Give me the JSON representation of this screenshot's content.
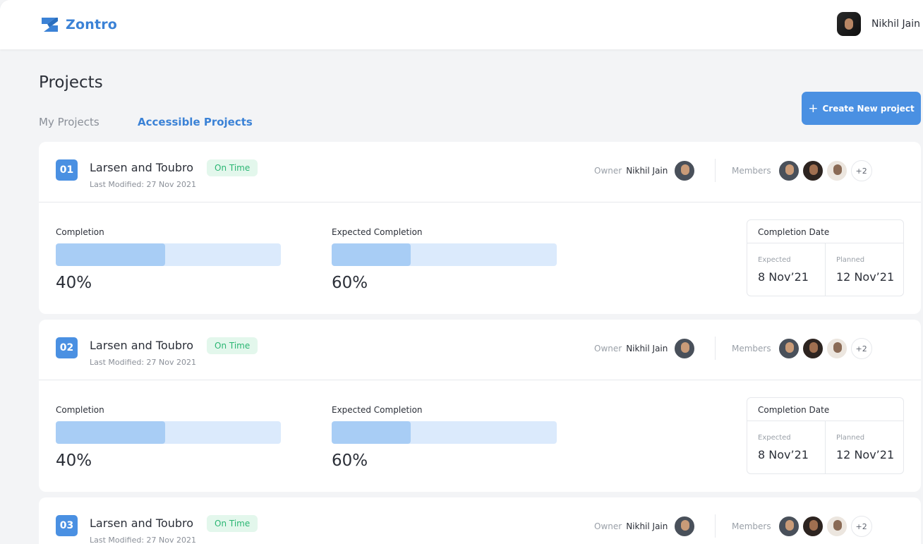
{
  "app": {
    "name": "Zontro",
    "brand_color": "#3b82d6"
  },
  "user": {
    "name": "Nikhil Jain"
  },
  "page": {
    "title": "Projects"
  },
  "tabs": [
    {
      "label": "My Projects",
      "active": false
    },
    {
      "label": "Accessible Projects",
      "active": true
    }
  ],
  "create_button": {
    "icon": "plus-icon",
    "label": "Create New project"
  },
  "projects": [
    {
      "number": "01",
      "name": "Larsen and Toubro",
      "status": "On Time",
      "last_modified": "Last Modified: 27 Nov 2021",
      "owner_label": "Owner",
      "owner_name": "Nikhil Jain",
      "members_label": "Members",
      "members_more": "+2",
      "completion_label": "Completion",
      "completion_value": "40%",
      "completion_fraction": 0.485,
      "expected_label": "Expected Completion",
      "expected_value": "60%",
      "expected_fraction": 0.35,
      "date_title": "Completion Date",
      "expected_date_label": "Expected",
      "expected_date": "8 Nov’21",
      "planned_date_label": "Planned",
      "planned_date": "12 Nov’21"
    },
    {
      "number": "02",
      "name": "Larsen and Toubro",
      "status": "On Time",
      "last_modified": "Last Modified: 27 Nov 2021",
      "owner_label": "Owner",
      "owner_name": "Nikhil Jain",
      "members_label": "Members",
      "members_more": "+2",
      "completion_label": "Completion",
      "completion_value": "40%",
      "completion_fraction": 0.485,
      "expected_label": "Expected Completion",
      "expected_value": "60%",
      "expected_fraction": 0.35,
      "date_title": "Completion Date",
      "expected_date_label": "Expected",
      "expected_date": "8 Nov’21",
      "planned_date_label": "Planned",
      "planned_date": "12 Nov’21"
    },
    {
      "number": "03",
      "name": "Larsen and Toubro",
      "status": "On Time",
      "last_modified": "Last Modified: 27 Nov 2021",
      "owner_label": "Owner",
      "owner_name": "Nikhil Jain",
      "members_label": "Members",
      "members_more": "+2"
    }
  ]
}
